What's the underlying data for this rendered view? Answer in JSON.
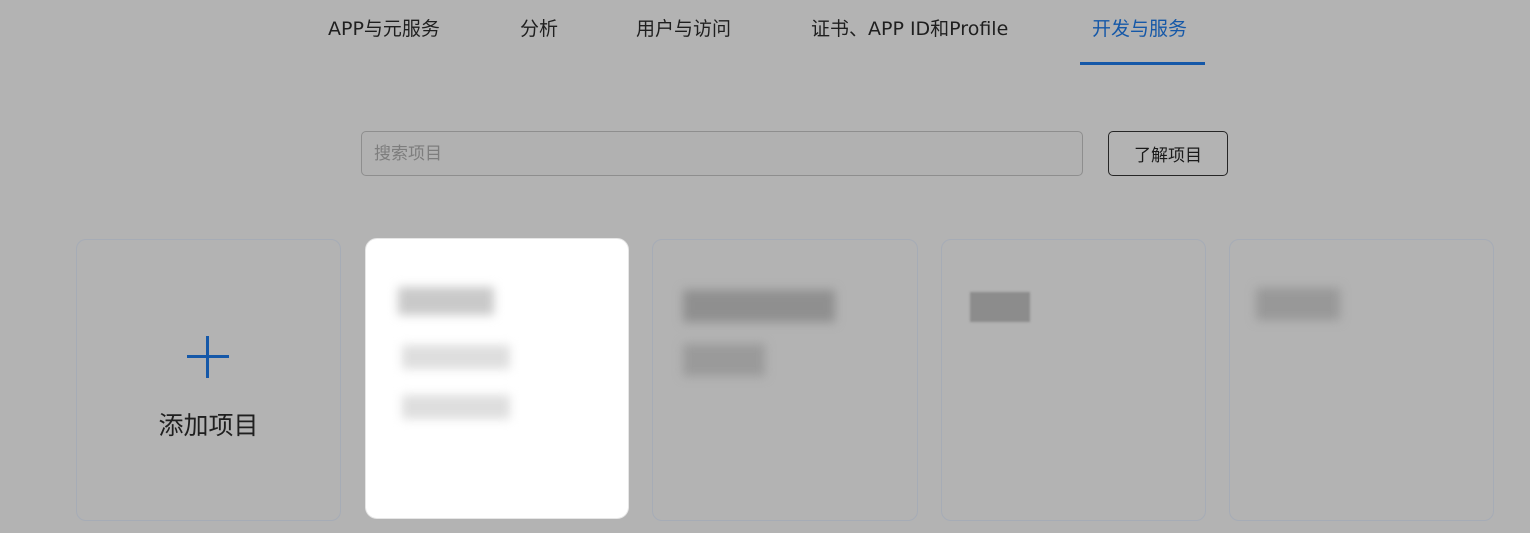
{
  "nav": {
    "tabs": [
      {
        "label": "APP与元服务",
        "active": false
      },
      {
        "label": "分析",
        "active": false
      },
      {
        "label": "用户与访问",
        "active": false
      },
      {
        "label": "证书、APP ID和Profile",
        "active": false
      },
      {
        "label": "开发与服务",
        "active": true
      }
    ]
  },
  "search": {
    "placeholder": "搜索项目",
    "value": ""
  },
  "learn_button": {
    "label": "了解项目"
  },
  "add_card": {
    "icon": "plus-icon",
    "label": "添加项目"
  },
  "colors": {
    "accent": "#1558a8",
    "overlay_background": "#b3b3b3",
    "highlight_card": "#ffffff"
  }
}
